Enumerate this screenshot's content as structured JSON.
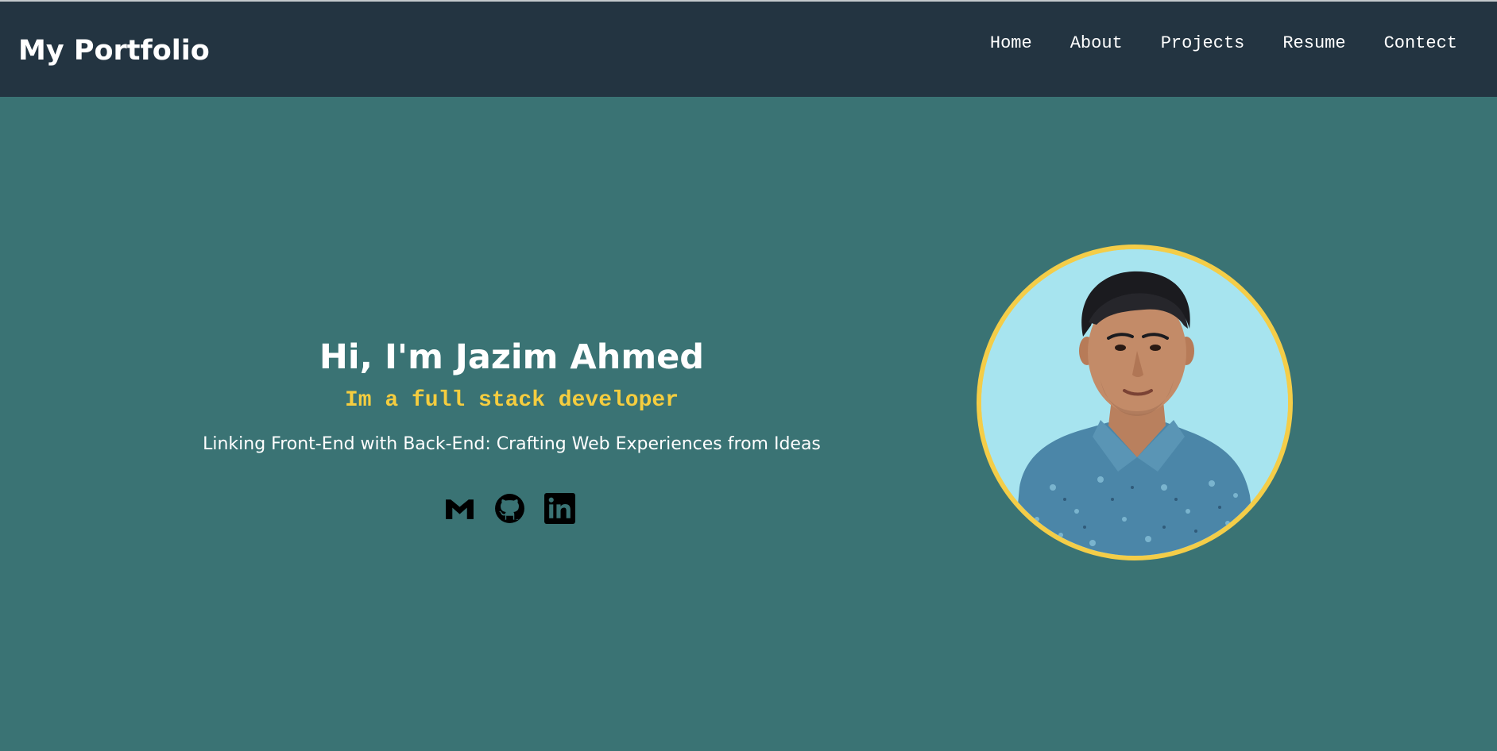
{
  "brand": {
    "title": "My Portfolio"
  },
  "nav": {
    "items": [
      {
        "label": "Home"
      },
      {
        "label": "About"
      },
      {
        "label": "Projects"
      },
      {
        "label": "Resume"
      },
      {
        "label": "Contect"
      }
    ]
  },
  "hero": {
    "greeting": "Hi, I'm Jazim Ahmed",
    "role": "Im a full stack developer",
    "tagline": "Linking Front-End with Back-End: Crafting Web Experiences from Ideas",
    "socials": [
      {
        "icon": "gmail-icon"
      },
      {
        "icon": "github-icon"
      },
      {
        "icon": "linkedin-icon"
      }
    ]
  },
  "colors": {
    "page_bg": "#3a7374",
    "navbar_bg": "#233441",
    "accent": "#f5cd3f",
    "avatar_bg": "#a7e4ef"
  }
}
